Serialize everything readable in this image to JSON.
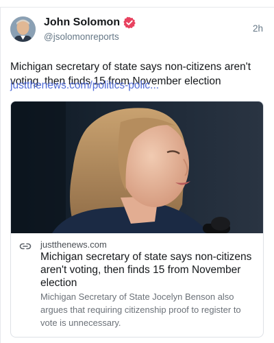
{
  "author": {
    "name": "John Solomon",
    "handle": "@jsolomonreports",
    "time": "2h"
  },
  "post": {
    "text": "Michigan secretary of state says non-citizens aren't voting, then finds 15 from November election",
    "link_text": "justthenews.com/politics-polic..."
  },
  "card": {
    "domain": "justthenews.com",
    "title": "Michigan secretary of state says non-citizens aren't voting, then finds 15 from November election",
    "description": "Michigan Secretary of State Jocelyn Benson also argues that requiring citizenship proof to register to vote is unnecessary."
  },
  "icons": {
    "verified": "verified-badge-icon",
    "link": "link-chain-icon"
  },
  "colors": {
    "verified": "#e8425f",
    "link": "#4f6bd8",
    "image_bg": "#1a2431"
  }
}
